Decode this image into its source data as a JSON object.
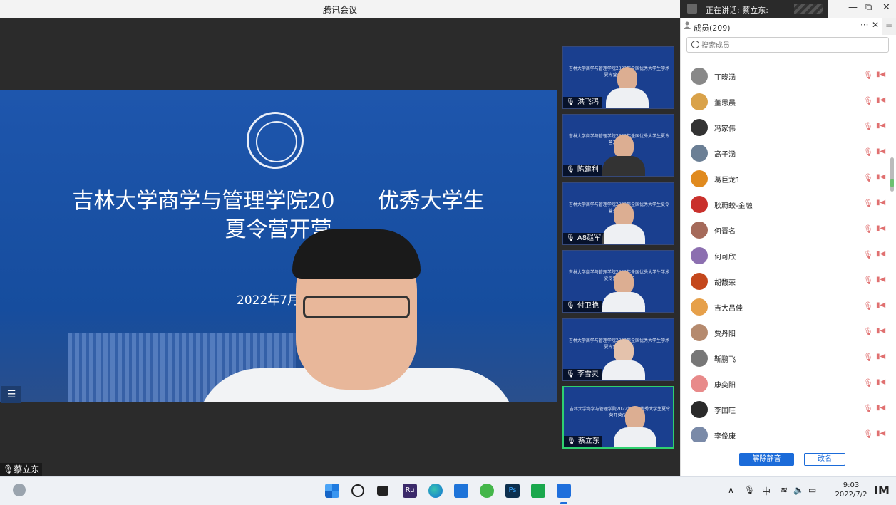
{
  "window": {
    "title": "腾讯会议",
    "speaking_label": "正在讲话: 蔡立东:",
    "controls": {
      "minimize": "—",
      "restore": "⧉",
      "close": "✕"
    }
  },
  "main_video": {
    "slide": {
      "title_line1": "吉林大学商学与管理学院20",
      "title_line1b": "优秀大学生",
      "title_line2": "夏令营开营",
      "date": "2022年7月2日"
    },
    "menu_icon": "☰",
    "speaker_name": "蔡立东"
  },
  "thumbnails": [
    {
      "name": "洪飞鸿",
      "slide_text": "吉林大学商学与管理学院2022年全国优秀大学生学术夏令营开营仪式"
    },
    {
      "name": "陈建利",
      "slide_text": "吉林大学商学与管理学院2022年全国优秀大学生夏令营开营仪式"
    },
    {
      "name": "A8赵军",
      "slide_text": "吉林大学商学与管理学院2022年全国优秀大学生夏令营开营仪式"
    },
    {
      "name": "付卫艳",
      "slide_text": "吉林大学商学与管理学院2022年全国优秀大学生学术夏令营开营仪式"
    },
    {
      "name": "李雪灵",
      "slide_text": "吉林大学商学与管理学院2022年全国优秀大学生学术夏令营开营仪式"
    },
    {
      "name": "蔡立东",
      "slide_text": "吉林大学商学与管理学院2022年全国优秀大学生夏令营开营仪式"
    }
  ],
  "panel": {
    "title": "成员(209)",
    "more": "···",
    "close": "✕",
    "collapse": "≡",
    "search_placeholder": "搜索成员",
    "members": [
      {
        "name": "丁晓涵",
        "color": "#888"
      },
      {
        "name": "董思晨",
        "color": "#d9a24a"
      },
      {
        "name": "冯家伟",
        "color": "#333"
      },
      {
        "name": "高子涵",
        "color": "#6b7f95"
      },
      {
        "name": "葛巨龙1",
        "color": "#e08a1e"
      },
      {
        "name": "耿蔚蛟-金融",
        "color": "#c9302c"
      },
      {
        "name": "何晋名",
        "color": "#a56a5a"
      },
      {
        "name": "何可欣",
        "color": "#8c6fb0"
      },
      {
        "name": "胡馥荣",
        "color": "#c4471c"
      },
      {
        "name": "吉大吕佳",
        "color": "#e6a04a"
      },
      {
        "name": "贾丹阳",
        "color": "#b58a6e"
      },
      {
        "name": "靳鹏飞",
        "color": "#777"
      },
      {
        "name": "康奕阳",
        "color": "#e88a8a"
      },
      {
        "name": "李国旺",
        "color": "#2a2a2a"
      },
      {
        "name": "李俊康",
        "color": "#7a8aa8"
      }
    ],
    "mic_icon": "🎙",
    "cam_icon": "▮◀",
    "unmute_label": "解除静音",
    "rename_label": "改名"
  },
  "taskbar": {
    "tray": {
      "chevron": "∧",
      "mic": "🎙",
      "ime": "中",
      "wifi": "≋",
      "volume": "🔈",
      "battery": "▭"
    },
    "time": "9:03",
    "date": "2022/7/2",
    "logo": "IM",
    "ru_label": "Ru",
    "ps_label": "Ps"
  }
}
